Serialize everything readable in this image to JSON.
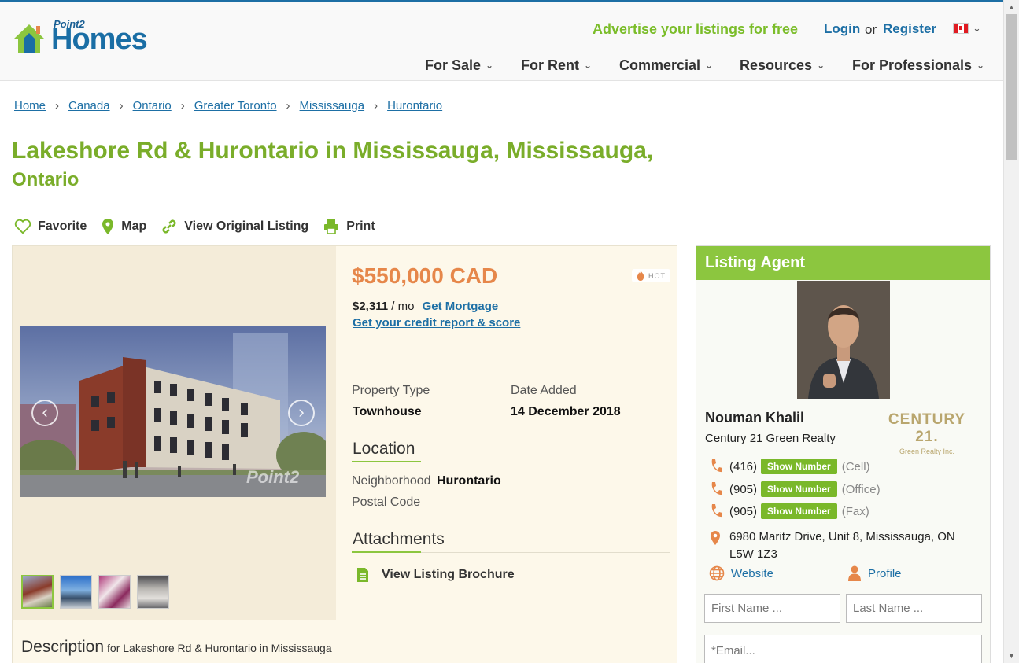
{
  "header": {
    "logo_point": "Point2",
    "logo_homes": "Homes",
    "advertise": "Advertise your listings for free",
    "login": "Login",
    "or": "or",
    "register": "Register"
  },
  "nav": [
    {
      "label": "For Sale"
    },
    {
      "label": "For Rent"
    },
    {
      "label": "Commercial"
    },
    {
      "label": "Resources"
    },
    {
      "label": "For Professionals"
    }
  ],
  "breadcrumb": [
    "Home",
    "Canada",
    "Ontario",
    "Greater Toronto",
    "Mississauga",
    "Hurontario"
  ],
  "title": {
    "line1": "Lakeshore Rd & Hurontario in Mississauga, Mississauga,",
    "line2": "Ontario"
  },
  "actions": {
    "favorite": "Favorite",
    "map": "Map",
    "view_original": "View Original Listing",
    "print": "Print"
  },
  "gallery": {
    "watermark": "Point2",
    "thumbnail_count": 4
  },
  "listing": {
    "price": "$550,000 CAD",
    "hot_badge": "HOT",
    "monthly_amount": "$2,311",
    "monthly_unit": "/ mo",
    "get_mortgage": "Get Mortgage",
    "credit_link": "Get your credit report & score",
    "property_type_label": "Property Type",
    "property_type_value": "Townhouse",
    "date_added_label": "Date Added",
    "date_added_value": "14 December 2018",
    "location_heading": "Location",
    "neighborhood_label": "Neighborhood",
    "neighborhood_value": "Hurontario",
    "postal_code_label": "Postal Code",
    "attachments_heading": "Attachments",
    "brochure": "View Listing Brochure",
    "description_heading": "Description",
    "description_sub": "for Lakeshore Rd & Hurontario in Mississauga"
  },
  "agent": {
    "heading": "Listing Agent",
    "name": "Nouman Khalil",
    "company": "Century 21 Green Realty",
    "brand_logo": "CENTURY 21.",
    "brand_logo_sub": "Green Realty Inc.",
    "phones": [
      {
        "area": "(416)",
        "button": "Show Number",
        "type": "(Cell)"
      },
      {
        "area": "(905)",
        "button": "Show Number",
        "type": "(Office)"
      },
      {
        "area": "(905)",
        "button": "Show Number",
        "type": "(Fax)"
      }
    ],
    "address_line1": "6980 Maritz Drive, Unit 8, Mississauga, ON",
    "address_line2": "L5W 1Z3",
    "website": "Website",
    "profile": "Profile",
    "form": {
      "first_name_placeholder": "First Name ...",
      "last_name_placeholder": "Last Name ...",
      "email_placeholder": "*Email..."
    }
  },
  "colors": {
    "brand_blue": "#1d6fa5",
    "brand_green": "#8cc63f",
    "price_orange": "#e6874a"
  }
}
